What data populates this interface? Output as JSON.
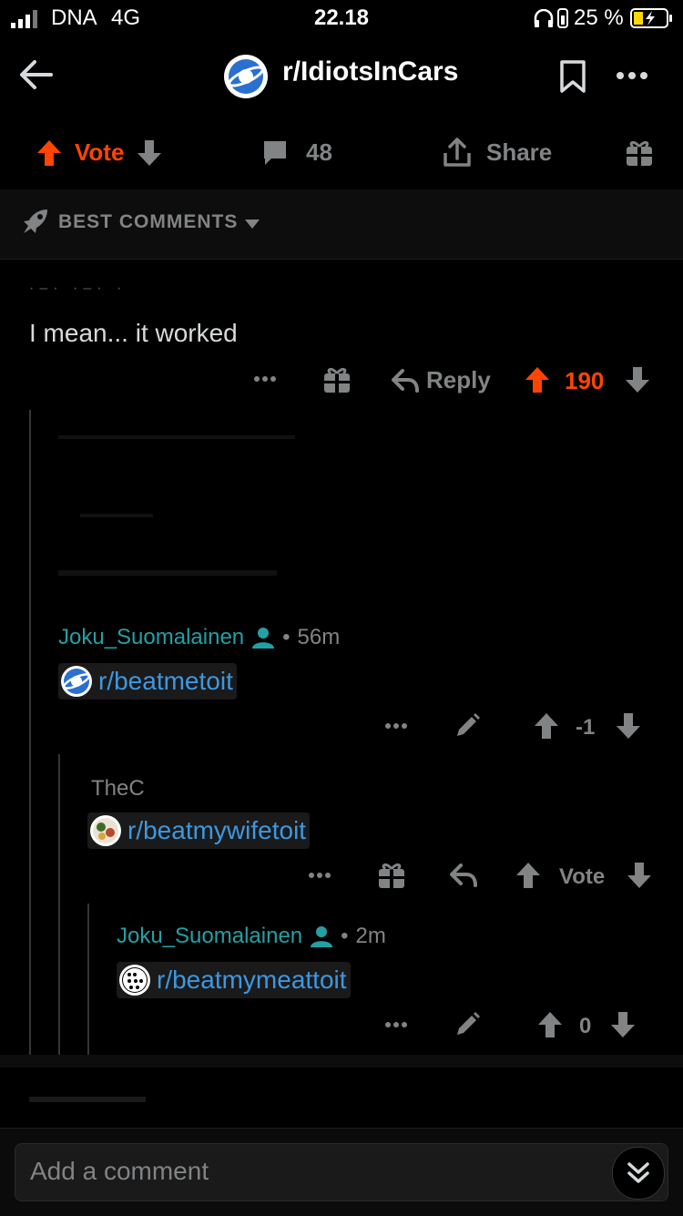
{
  "status_bar": {
    "carrier": "DNA",
    "network": "4G",
    "time": "22.18",
    "battery": "25 %"
  },
  "nav": {
    "subreddit": "r/IdiotsInCars"
  },
  "actions": {
    "vote_label": "Vote",
    "comments_count": "48",
    "share_label": "Share"
  },
  "sort": {
    "label": "BEST COMMENTS"
  },
  "comments": [
    {
      "body": "I mean... it worked",
      "reply_label": "Reply",
      "score": "190"
    },
    {
      "author": "Joku_Suomalainen",
      "age": "56m",
      "link": "r/beatmetoit",
      "score": "-1"
    },
    {
      "author_partial": "TheC",
      "link": "r/beatmywifetoit",
      "vote_label": "Vote"
    },
    {
      "author": "Joku_Suomalainen",
      "age": "2m",
      "link": "r/beatmymeattoit",
      "score": "0"
    }
  ],
  "composer": {
    "placeholder": "Add a comment"
  },
  "colors": {
    "upvote": "#ff4500",
    "author": "#24a0a4",
    "link": "#3d98e0",
    "background": "#000000"
  }
}
